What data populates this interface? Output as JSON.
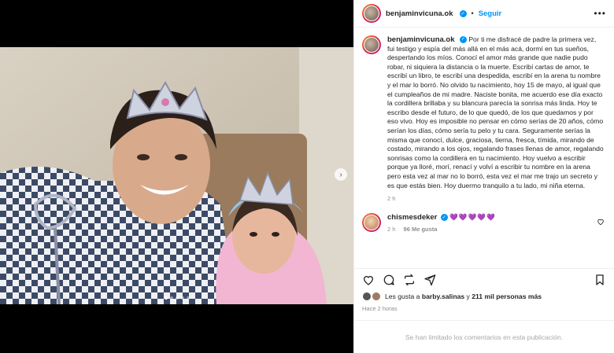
{
  "post": {
    "username": "benjaminvicuna.ok",
    "separator": "•",
    "follow_label": "Seguir",
    "more_label": "•••",
    "caption": "Por ti me disfracé de padre la primera vez, fui testigo y espía del más allá en el más acá, dormí en tus sueños, despertando los míos. Conocí el amor más grande que nadie pudo robar, ni siquiera la distancia o la muerte. Escribí cartas de amor, te escribí un libro, te escribí una despedida, escribí en la arena tu nombre y el mar lo borró. No olvido tu nacimiento, hoy 15 de mayo, al igual que el cumpleaños de mi madre. Naciste bonita, me acuerdo ese día exacto la cordillera brillaba y su blancura parecía la sonrisa más linda. Hoy te escribo desde el futuro, de lo que quedó, de los que quedamos y por eso vivo. Hoy es imposible no pensar en cómo serías de 20 años, cómo serían los días, cómo sería tu pelo y tu cara. Seguramente serías la misma que conocí, dulce, graciosa, tierna, fresca, tímida, mirando de costado, mirando a los ojos, regalando frases llenas de amor, regalando sonrisas como la cordillera en tu nacimiento. Hoy vuelvo a escribir porque ya lloré, morí, renací y volví a escribir tu nombre en la arena pero esta vez al mar no lo borró, esta vez el mar me trajo un secreto y es que estás bien. Hoy duermo tranquilo a tu lado, mi niña eterna.",
    "caption_time": "2 h",
    "media_dots": 5,
    "media_active_dot": 0
  },
  "comments": [
    {
      "username": "chismesdeker",
      "text": "💜💜💜💜💜",
      "time": "2 h",
      "likes": "96 Me gusta"
    }
  ],
  "likes": {
    "prefix": "Les gusta a ",
    "user": "barby.salinas",
    "connector": " y ",
    "others": "211 mil personas más"
  },
  "date_label": "Hace 2 horas",
  "comments_limited": "Se han limitado los comentarios en esta publicación.",
  "icons": {
    "verified": "verified-badge",
    "next": "chevron-right-icon",
    "like": "heart-icon",
    "comment": "comment-icon",
    "share": "share-icon",
    "save": "bookmark-icon"
  },
  "colors": {
    "accent": "#0095f6",
    "text": "#262626",
    "muted": "#8e8e8e"
  }
}
